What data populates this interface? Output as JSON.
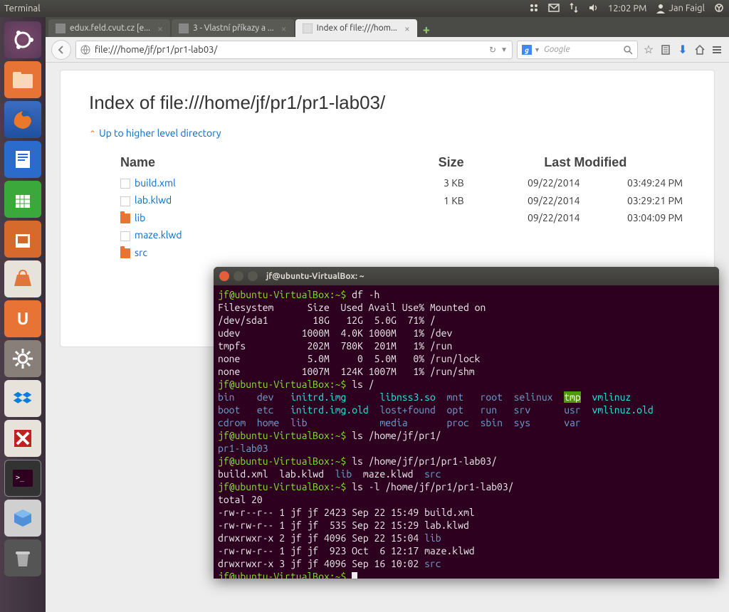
{
  "menubar": {
    "app": "Terminal",
    "time": "12:02 PM",
    "user": "Jan Faigl"
  },
  "tabs": [
    {
      "label": "edux.feld.cvut.cz [e...",
      "active": false
    },
    {
      "label": "3 - Vlastní příkazy a ...",
      "active": false
    },
    {
      "label": "Index of file:///hom...",
      "active": true
    }
  ],
  "url": "file:///home/jf/pr1/pr1-lab03/",
  "search_placeholder": "Google",
  "page": {
    "title": "Index of file:///home/jf/pr1/pr1-lab03/",
    "uplink": "Up to higher level directory",
    "headers": {
      "name": "Name",
      "size": "Size",
      "modified": "Last Modified"
    },
    "rows": [
      {
        "type": "file",
        "name": "build.xml",
        "size": "3 KB",
        "date": "09/22/2014",
        "time": "03:49:24 PM"
      },
      {
        "type": "file",
        "name": "lab.klwd",
        "size": "1 KB",
        "date": "09/22/2014",
        "time": "03:29:21 PM"
      },
      {
        "type": "folder",
        "name": "lib",
        "size": "",
        "date": "09/22/2014",
        "time": "03:04:09 PM"
      },
      {
        "type": "file",
        "name": "maze.klwd",
        "size": "",
        "date": "",
        "time": ""
      },
      {
        "type": "folder",
        "name": "src",
        "size": "",
        "date": "",
        "time": ""
      }
    ]
  },
  "terminal": {
    "title": "jf@ubuntu-VirtualBox: ~",
    "prompt": "jf@ubuntu-VirtualBox:~$",
    "df_cmd": "df -h",
    "df_header": "Filesystem      Size  Used Avail Use% Mounted on",
    "df_rows": [
      "/dev/sda1        18G   12G  5.0G  71% /",
      "udev           1000M  4.0K 1000M   1% /dev",
      "tmpfs           202M  780K  201M   1% /run",
      "none            5.0M     0  5.0M   0% /run/lock",
      "none           1007M  124K 1007M   1% /run/shm"
    ],
    "ls_root_cmd": "ls /",
    "ls_root": {
      "blue": [
        "bin",
        "dev"
      ],
      "cyan1": [
        "initrd.img"
      ],
      "cyan2": [
        "libnss3.so"
      ],
      "blue2": [
        "mnt",
        "root",
        "selinux"
      ],
      "tmp": "tmp",
      "cyan3": "vmlinuz",
      "line2_blue": [
        "boot",
        "etc"
      ],
      "line2_cyan": "initrd.img.old",
      "line2_blue2": [
        "lost+found",
        "opt",
        "run",
        "srv"
      ],
      "line2_blue3": "usr",
      "line2_cyan2": "vmlinuz.old",
      "line3_blue": [
        "cdrom",
        "home",
        "lib"
      ],
      "line3_blue2": [
        "media",
        "proc",
        "sbin",
        "sys"
      ],
      "line3_blue3": "var"
    },
    "ls_home_cmd": "ls /home/jf/pr1/",
    "ls_home_out": "pr1-lab03",
    "ls_lab_cmd": "ls /home/jf/pr1/pr1-lab03/",
    "ls_lab_out_plain": "build.xml  lab.klwd  ",
    "ls_lab_out_lib": "lib",
    "ls_lab_out_mid": "  maze.klwd  ",
    "ls_lab_out_src": "src",
    "lsl_cmd": "ls -l /home/jf/pr1/pr1-lab03/",
    "lsl_total": "total 20",
    "lsl_rows": [
      {
        "pre": "-rw-r--r-- 1 jf jf 2423 Sep 22 15:49 ",
        "name": "build.xml",
        "cls": ""
      },
      {
        "pre": "-rw-rw-r-- 1 jf jf  535 Sep 22 15:29 ",
        "name": "lab.klwd",
        "cls": ""
      },
      {
        "pre": "drwxrwxr-x 2 jf jf 4096 Sep 22 15:04 ",
        "name": "lib",
        "cls": "c-blue"
      },
      {
        "pre": "-rw-rw-r-- 1 jf jf  923 Oct  6 12:17 ",
        "name": "maze.klwd",
        "cls": ""
      },
      {
        "pre": "drwxrwxr-x 3 jf jf 4096 Sep 16 10:02 ",
        "name": "src",
        "cls": "c-blue"
      }
    ]
  }
}
